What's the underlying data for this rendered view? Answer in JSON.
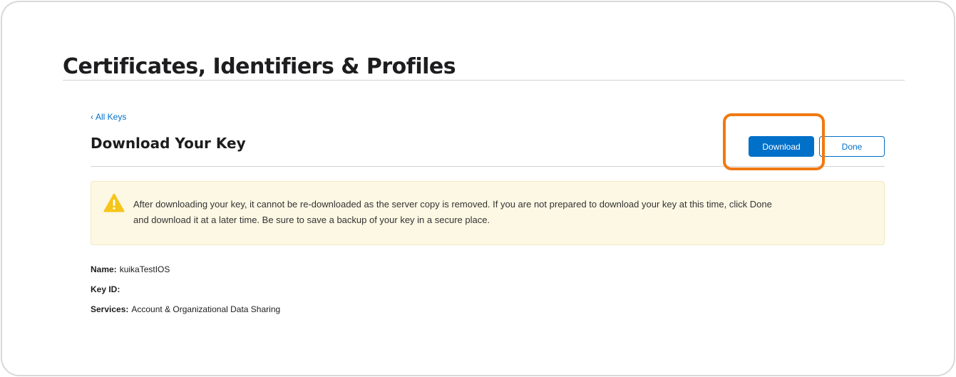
{
  "page": {
    "title": "Certificates, Identifiers & Profiles"
  },
  "nav": {
    "back_chevron": "‹",
    "back_label": "All Keys"
  },
  "section": {
    "title": "Download Your Key"
  },
  "actions": {
    "download_label": "Download",
    "done_label": "Done",
    "primary_color": "#0070c9",
    "highlight_color": "#f07a12"
  },
  "alert": {
    "icon": "warning-icon",
    "text": "After downloading your key, it cannot be re-downloaded as the server copy is removed. If you are not prepared to download your key at this time, click Done and download it at a later time. Be sure to save a backup of your key in a secure place.",
    "background": "#fdf8e4"
  },
  "details": {
    "name_label": "Name:",
    "name_value": "kuikaTestIOS",
    "keyid_label": "Key ID:",
    "keyid_value": "",
    "services_label": "Services:",
    "services_value": "Account & Organizational Data Sharing"
  }
}
